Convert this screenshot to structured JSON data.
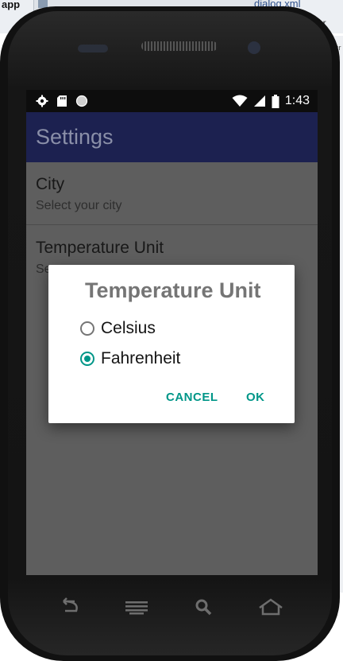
{
  "ide": {
    "app_label": "app",
    "file_tab": "dialog.xml",
    "file_tab2": "ity_r",
    "side_text": "cr"
  },
  "status_bar": {
    "time": "1:43",
    "icons_left": [
      "gear-icon",
      "sd-card-icon",
      "circle-icon"
    ],
    "icons_right": [
      "wifi-icon",
      "signal-icon",
      "battery-icon"
    ]
  },
  "toolbar": {
    "title": "Settings"
  },
  "preferences": [
    {
      "title": "City",
      "summary": "Select your city"
    },
    {
      "title": "Temperature Unit",
      "summary": "Se"
    }
  ],
  "dialog": {
    "title": "Temperature Unit",
    "options": [
      {
        "label": "Celsius",
        "checked": false
      },
      {
        "label": "Fahrenheit",
        "checked": true
      }
    ],
    "cancel_label": "CANCEL",
    "ok_label": "OK"
  },
  "nav_bar": {
    "buttons": [
      "back-icon",
      "menu-icon",
      "search-icon",
      "home-icon"
    ]
  },
  "colors": {
    "toolbar": "#1c2150",
    "accent": "#009688",
    "scrim": "#5e5e5e"
  }
}
